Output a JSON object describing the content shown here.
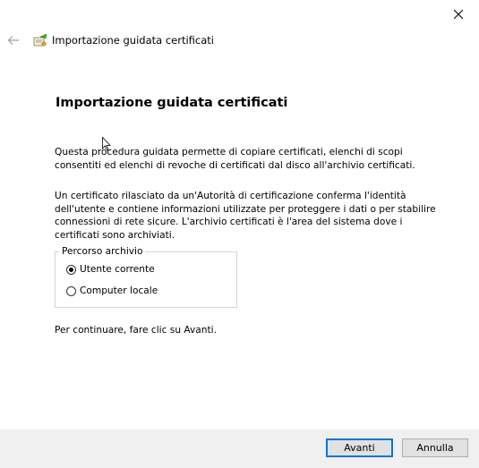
{
  "window": {
    "title": "Importazione guidata certificati",
    "close_icon": "close-icon",
    "back_icon": "back-arrow-icon",
    "wizard_icon": "certificate-icon"
  },
  "page": {
    "heading": "Importazione guidata certificati",
    "paragraph1": "Questa procedura guidata permette di copiare certificati, elenchi di scopi consentiti ed elenchi di revoche di certificati dal disco all'archivio certificati.",
    "paragraph2": "Un certificato rilasciato da un'Autorità di certificazione conferma l'identità dell'utente e contiene informazioni utilizzate per proteggere i dati o per stabilire connessioni di rete sicure. L'archivio certificati è l'area del sistema dove i certificati sono archiviati.",
    "store_location": {
      "legend": "Percorso archivio",
      "options": [
        {
          "label": "Utente corrente",
          "checked": true
        },
        {
          "label": "Computer locale",
          "checked": false
        }
      ]
    },
    "continue_text": "Per continuare, fare clic su Avanti."
  },
  "footer": {
    "next_label": "Avanti",
    "cancel_label": "Annulla",
    "accent_color": "#0078d7"
  }
}
